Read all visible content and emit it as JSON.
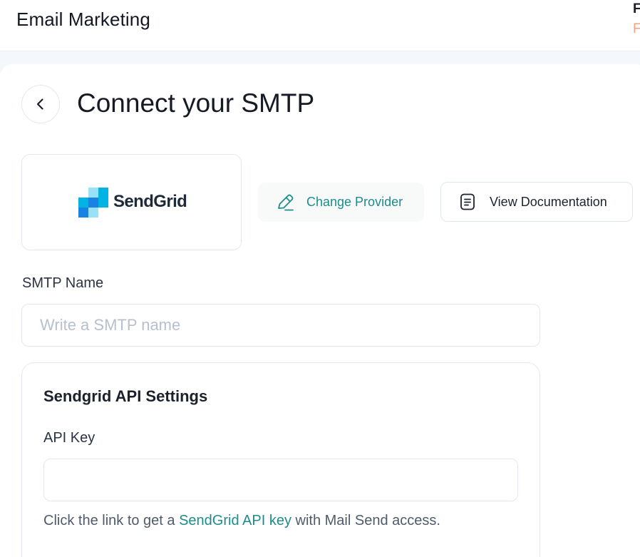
{
  "header": {
    "app_title": "Email Marketing",
    "corner_top": "F",
    "corner_bottom": "F"
  },
  "page": {
    "title": "Connect your SMTP",
    "back_icon": "chevron-left-icon"
  },
  "provider": {
    "name": "SendGrid",
    "logo_icon": "sendgrid-logo",
    "brand_colors": [
      "#1A82E2",
      "#00B3E3",
      "#99E1F4"
    ]
  },
  "actions": {
    "change_provider": {
      "label": "Change Provider",
      "icon": "pencil-icon"
    },
    "view_docs": {
      "label": "View Documentation",
      "icon": "document-icon"
    }
  },
  "form": {
    "smtp_name": {
      "label": "SMTP Name",
      "placeholder": "Write a SMTP name",
      "value": ""
    },
    "api_settings": {
      "title": "Sendgrid API Settings",
      "api_key": {
        "label": "API Key",
        "value": ""
      },
      "help_prefix": "Click the link to get a ",
      "help_link": "SendGrid API key",
      "help_suffix": " with Mail Send access."
    }
  },
  "colors": {
    "accent": "#1E8C8C",
    "corner_accent": "#F3A27C",
    "page_bg": "#F4F7FB"
  }
}
